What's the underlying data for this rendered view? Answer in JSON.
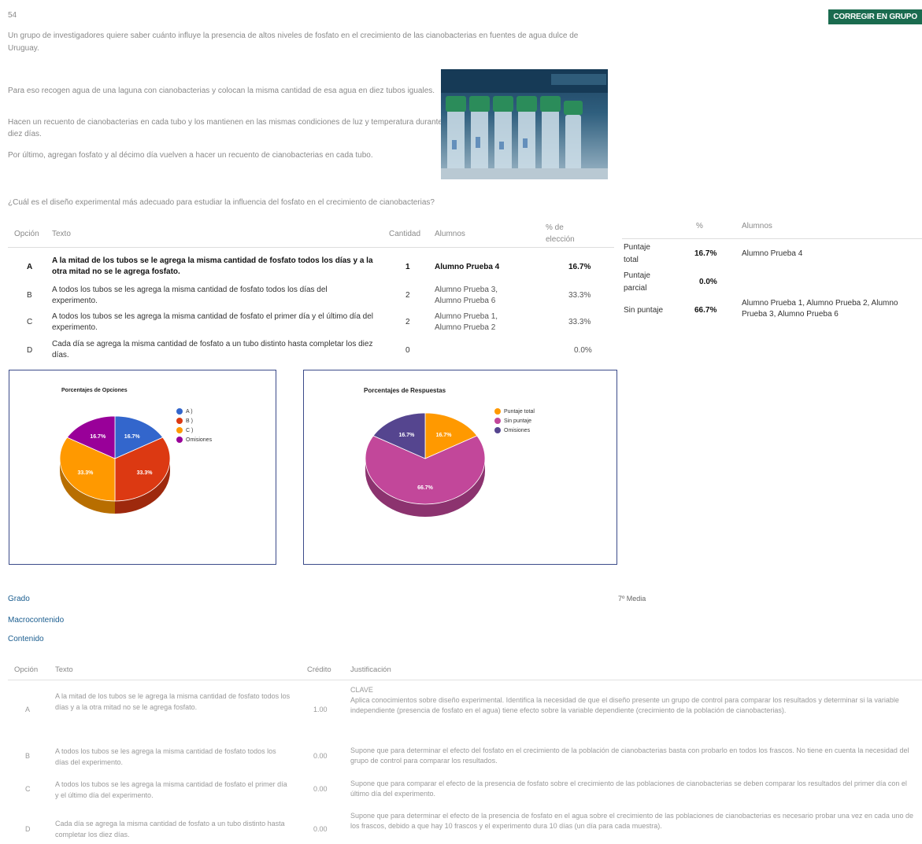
{
  "question": {
    "number": "54",
    "intro": "Un grupo de investigadores quiere saber cuánto influye la presencia de altos niveles de fosfato en el crecimiento de las cianobacterias en fuentes de agua dulce de Uruguay.",
    "paragraphs": [
      "Para eso recogen agua de una laguna con cianobacterias y colocan la misma cantidad de esa agua en diez tubos iguales.",
      "Hacen un recuento de cianobacterias en cada tubo y los mantienen en las mismas condiciones de luz y temperatura durante diez días.",
      "Por último, agregan fosfato y al décimo día vuelven a hacer un recuento de cianobacterias en cada tubo."
    ],
    "prompt": "¿Cuál es el diseño experimental más adecuado para estudiar la influencia del fosfato en el crecimiento de cianobacterias?"
  },
  "toolbar": {
    "corregir_label": "CORREGIR EN GRUPO"
  },
  "options_table": {
    "headers": {
      "opcion": "Opción",
      "texto": "Texto",
      "cantidad": "Cantidad",
      "alumnos": "Alumnos",
      "pct": "% de elección"
    },
    "rows": [
      {
        "opcion": "A",
        "texto": "A la mitad de los tubos se le agrega la misma cantidad de fosfato todos los días y a la otra mitad no se le agrega fosfato.",
        "cantidad": "1",
        "alumnos": "Alumno Prueba 4",
        "pct": "16.7%"
      },
      {
        "opcion": "B",
        "texto": "A todos los tubos se les agrega la misma cantidad de fosfato todos los días del experimento.",
        "cantidad": "2",
        "alumnos": "Alumno Prueba 3, Alumno Prueba 6",
        "pct": "33.3%"
      },
      {
        "opcion": "C",
        "texto": "A todos los tubos se les agrega la misma cantidad de fosfato el primer día y el último día del experimento.",
        "cantidad": "2",
        "alumnos": "Alumno Prueba 1, Alumno Prueba 2",
        "pct": "33.3%"
      },
      {
        "opcion": "D",
        "texto": "Cada día se agrega la misma cantidad de fosfato a un tubo distinto hasta completar los diez días.",
        "cantidad": "0",
        "alumnos": "",
        "pct": "0.0%"
      }
    ]
  },
  "scores_table": {
    "headers": {
      "pct": "%",
      "alumnos": "Alumnos"
    },
    "rows": [
      {
        "label": "Puntaje total",
        "pct": "16.7%",
        "alumnos": "Alumno Prueba 4"
      },
      {
        "label": "Puntaje parcial",
        "pct": "0.0%",
        "alumnos": ""
      },
      {
        "label": "Sin puntaje",
        "pct": "66.7%",
        "alumnos": "Alumno Prueba 1, Alumno Prueba 2, Alumno Prueba 3, Alumno Prueba 6"
      }
    ]
  },
  "chart_data": [
    {
      "type": "pie",
      "title": "Porcentajes de Opciones",
      "categories": [
        "A ) ",
        "B ) ",
        "C ) ",
        "Omisiones"
      ],
      "values": [
        16.7,
        33.3,
        33.3,
        16.7
      ],
      "labels": [
        "16.7%",
        "33.3%",
        "33.3%",
        "16.7%"
      ],
      "colors": [
        "#3366cc",
        "#dc3912",
        "#ff9900",
        "#990099"
      ],
      "legend_position": "right"
    },
    {
      "type": "pie",
      "title": "Porcentajes de Respuestas",
      "categories": [
        "Puntaje total",
        "Sin puntaje",
        "Omisiones"
      ],
      "values": [
        16.7,
        66.7,
        16.7
      ],
      "labels": [
        "16.7%",
        "66.7%",
        "16.7%"
      ],
      "colors": [
        "#ff9900",
        "#c2479a",
        "#55458f"
      ],
      "legend_position": "right"
    }
  ],
  "meta": {
    "grado_label": "Grado",
    "grado_value": "7º Media",
    "macrocontenido_label": "Macrocontenido",
    "contenido_label": "Contenido"
  },
  "justification_table": {
    "headers": {
      "opcion": "Opción",
      "texto": "Texto",
      "credito": "Crédito",
      "justificacion": "Justificación"
    },
    "rows": [
      {
        "opcion": "A",
        "texto": "A la mitad de los tubos se le agrega la misma cantidad de fosfato todos los días y a la otra mitad no se le agrega fosfato.",
        "credito": "1.00",
        "justificacion": "CLAVE\nAplica conocimientos sobre diseño experimental. Identifica la necesidad de que el diseño presente un grupo de control para comparar los resultados y determinar si la variable independiente (presencia de fosfato en el agua) tiene efecto sobre la variable dependiente (crecimiento de la población de cianobacterias)."
      },
      {
        "opcion": "B",
        "texto": "A todos los tubos se les agrega la misma cantidad de fosfato todos los días del experimento.",
        "credito": "0.00",
        "justificacion": "Supone que para determinar el efecto del fosfato en el crecimiento de la población de cianobacterias basta con probarlo en todos los frascos. No tiene en cuenta la necesidad del grupo de control para comparar los resultados."
      },
      {
        "opcion": "C",
        "texto": "A todos los tubos se les agrega la misma cantidad de fosfato el primer día y el último día del experimento.",
        "credito": "0.00",
        "justificacion": "Supone que para comparar el efecto de la presencia de fosfato sobre el crecimiento de las poblaciones de cianobacterias se deben comparar los resultados del primer día con el último día del experimento."
      },
      {
        "opcion": "D",
        "texto": "Cada día se agrega la misma cantidad de fosfato a un tubo distinto hasta completar los diez días.",
        "credito": "0.00",
        "justificacion": "Supone que para determinar el efecto de la presencia de fosfato en el agua sobre el crecimiento de las poblaciones de cianobacterias es necesario probar una vez en cada uno de los frascos, debido a que hay 10 frascos y el experimento dura 10 días (un día para cada muestra)."
      }
    ]
  }
}
